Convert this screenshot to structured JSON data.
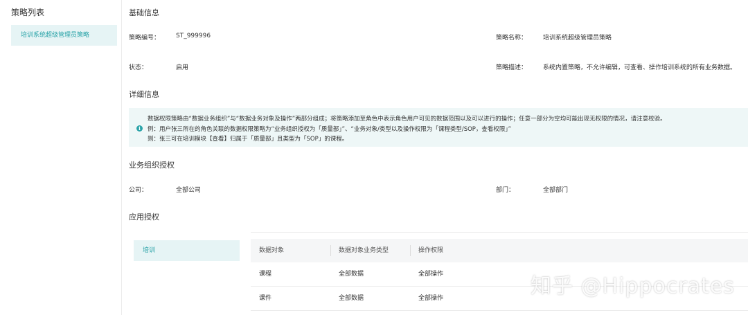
{
  "sidebar": {
    "title": "策略列表",
    "items": [
      {
        "label": "培训系统超级管理员策略"
      }
    ]
  },
  "basic_info": {
    "title": "基础信息",
    "policy_no_label": "策略编号：",
    "policy_no_value": "ST_999996",
    "policy_name_label": "策略名称：",
    "policy_name_value": "培训系统超级管理员策略",
    "status_label": "状态：",
    "status_value": "启用",
    "desc_label": "策略描述：",
    "desc_value": "系统内置策略，不允许编辑，可查看、操作培训系统的所有业务数据。"
  },
  "detail": {
    "title": "详细信息",
    "info_lines": [
      "数据权限策略由“数据业务组织”与“数据业务对象及操作”两部分组成；将策略添加至角色中表示角色用户可见的数据范围以及可以进行的操作；任意一部分为空均可能出现无权限的情况，请注意校验。",
      "例：用户张三所在的角色关联的数据权限策略为“业务组织授权为「质量部」”、“业务对象/类型以及操作权限为「课程类型/SOP，查看权限」”",
      "则：张三可在培训模块【查看】归属于「质量部」且类型为「SOP」的课程。"
    ]
  },
  "org_auth": {
    "title": "业务组织授权",
    "company_label": "公司：",
    "company_value": "全部公司",
    "dept_label": "部门：",
    "dept_value": "全部部门"
  },
  "app_auth": {
    "title": "应用授权",
    "apps": [
      {
        "label": "培训"
      }
    ],
    "table": {
      "headers": [
        "数据对象",
        "数据对象业务类型",
        "操作权限"
      ],
      "rows": [
        [
          "课程",
          "全部数据",
          "全部操作"
        ],
        [
          "课件",
          "全部数据",
          "全部操作"
        ]
      ]
    }
  },
  "watermark": "知乎 @Hippocrates",
  "colors": {
    "accent": "#2aa3a8",
    "selected_bg": "#e6f4f5",
    "info_bg": "#eef7f7"
  }
}
